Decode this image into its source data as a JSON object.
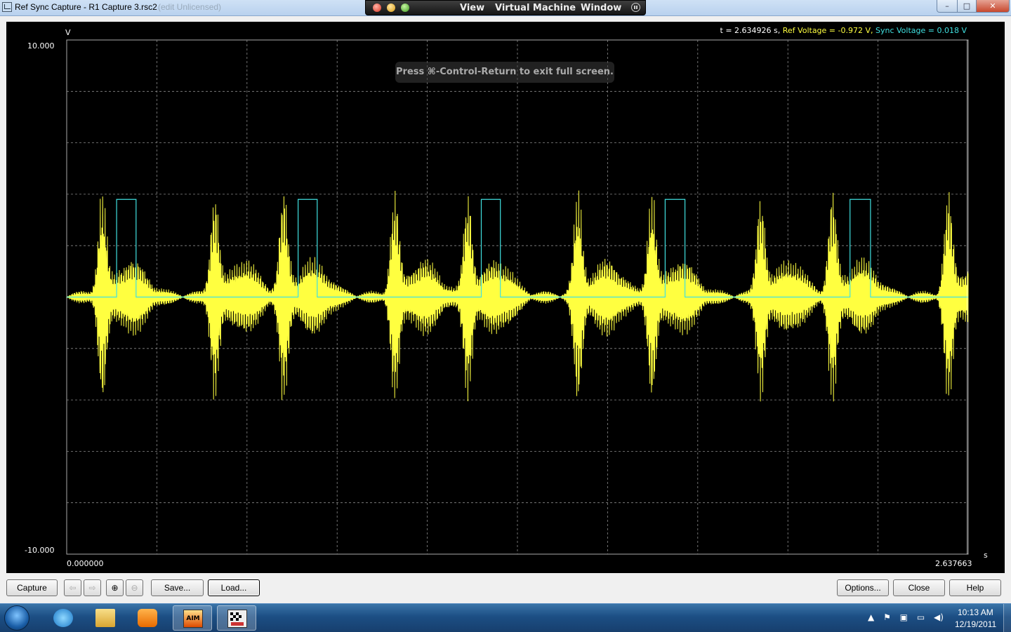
{
  "window": {
    "title": "Ref Sync Capture - R1 Capture 3.rsc2",
    "title_faded": "(edit Unlicensed)",
    "min_glyph": "–",
    "max_glyph": "□",
    "close_glyph": "✕"
  },
  "vm_menu": {
    "items": [
      "View",
      "Virtual Machine",
      "Window"
    ]
  },
  "scope": {
    "y_unit": "V",
    "y_max": "10.000",
    "y_min": "-10.000",
    "x_min": "0.000000",
    "x_max": "2.637663",
    "x_unit": "s",
    "readout": {
      "time": "t = 2.634926 s,",
      "ref": "Ref Voltage = -0.972 V,",
      "sync": "Sync Voltage =  0.018 V"
    },
    "fullscreen_hint": "Press ⌘-Control-Return to exit full screen."
  },
  "chart_data": {
    "type": "line",
    "xlim": [
      0.0,
      2.637663
    ],
    "ylim": [
      -10.0,
      10.0
    ],
    "y_divisions": 10,
    "x_divisions": 10,
    "grid": true,
    "series": [
      {
        "name": "Ref Voltage",
        "color": "#ffff40",
        "kind": "burst-waveform",
        "burst_peak_times": [
          0.104,
          0.433,
          0.635,
          0.96,
          1.174,
          1.496,
          1.712,
          2.031,
          2.241,
          2.58
        ],
        "burst_peak_amplitudes": [
          4.0,
          4.0,
          4.0,
          4.0,
          4.0,
          4.0,
          4.0,
          4.0,
          4.0,
          4.0
        ],
        "baseline_amplitude": 1.5
      },
      {
        "name": "Sync Voltage",
        "color": "#40e0e0",
        "kind": "pulse-train",
        "low": 0.0,
        "high": 3.8,
        "pulses": [
          [
            0.146,
            0.203
          ],
          [
            0.677,
            0.733
          ],
          [
            1.213,
            1.269
          ],
          [
            1.751,
            1.809
          ],
          [
            2.292,
            2.352
          ]
        ]
      }
    ]
  },
  "toolbar": {
    "capture": "Capture",
    "back": "⇦",
    "forward": "⇨",
    "zoom_in": "⊕",
    "zoom_out": "⊖",
    "save": "Save...",
    "load": "Load...",
    "options": "Options...",
    "close": "Close",
    "help": "Help"
  },
  "taskbar": {
    "apps": [
      {
        "name": "Internet Explorer",
        "icon": "ie-icon"
      },
      {
        "name": "Windows Explorer",
        "icon": "folder-icon"
      },
      {
        "name": "Windows Media Player",
        "icon": "media-player-icon"
      },
      {
        "name": "AIM",
        "icon": "aim-icon",
        "label": "AIM"
      },
      {
        "name": "Ref Sync Capture",
        "icon": "race-flag-icon"
      }
    ],
    "tray_icons": [
      "chevron-up-icon",
      "flag-icon",
      "network-adapter-icon",
      "monitor-icon",
      "volume-icon"
    ],
    "clock_time": "10:13 AM",
    "clock_date": "12/19/2011"
  }
}
